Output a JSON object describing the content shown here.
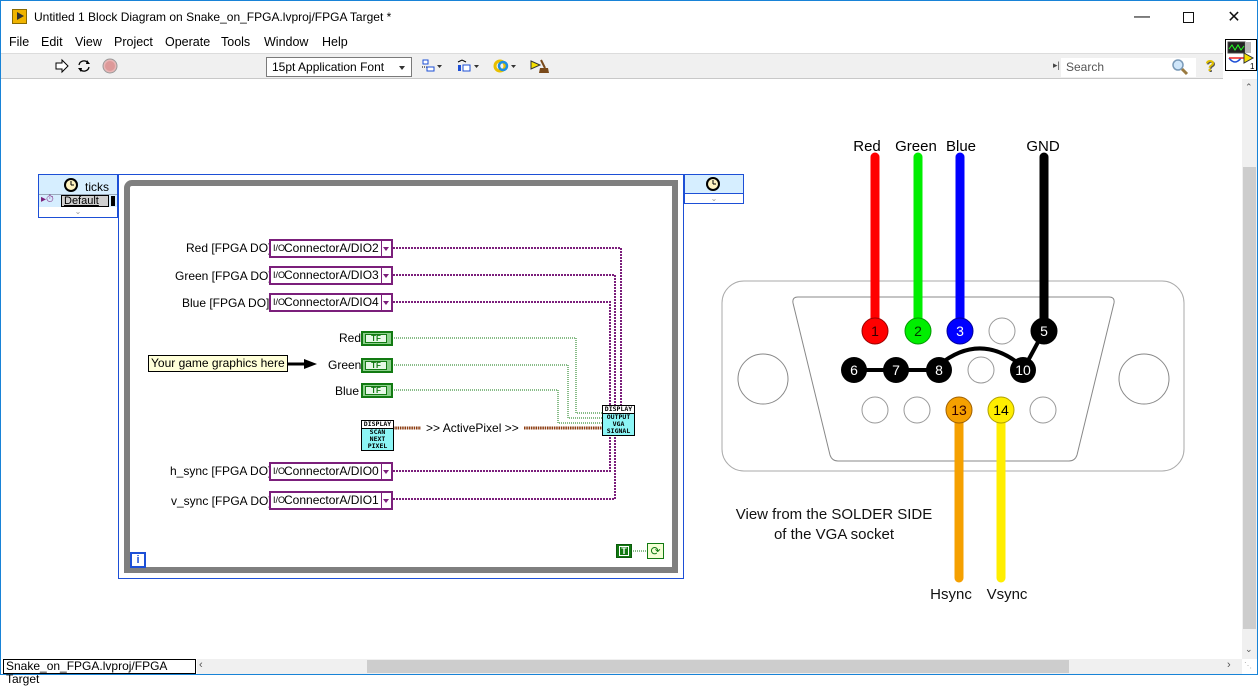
{
  "window": {
    "title": "Untitled 1 Block Diagram on Snake_on_FPGA.lvproj/FPGA Target *",
    "minimize_icon": "minimize-icon",
    "maximize_icon": "maximize-icon",
    "close_icon": "close-icon"
  },
  "menu": [
    "File",
    "Edit",
    "View",
    "Project",
    "Operate",
    "Tools",
    "Window",
    "Help"
  ],
  "toolbar": {
    "run_icon": "run-arrow-icon",
    "run_continuous_icon": "run-continuously-icon",
    "abort_icon": "abort-icon",
    "font_select": "15pt Application Font",
    "align_icon": "align-objects-icon",
    "distribute_icon": "distribute-objects-icon",
    "reorder_icon": "reorder-icon",
    "cleanup_icon": "clean-up-diagram-icon",
    "search_placeholder": "Search",
    "help_icon": "?"
  },
  "diagram": {
    "timed_loop": {
      "source_label": "ticks",
      "timing_source": "Default"
    },
    "io_nodes": [
      {
        "label": "Red [FPGA DO]",
        "channel": "ConnectorA/DIO2"
      },
      {
        "label": "Green [FPGA DO]",
        "channel": "ConnectorA/DIO3"
      },
      {
        "label": "Blue [FPGA DO]",
        "channel": "ConnectorA/DIO4"
      },
      {
        "label": "h_sync [FPGA DO]",
        "channel": "ConnectorA/DIO0"
      },
      {
        "label": "v_sync [FPGA DO]",
        "channel": "ConnectorA/DIO1"
      }
    ],
    "io_icon_text": "I/O",
    "bool_controls": [
      {
        "label": "Red",
        "text": "TF"
      },
      {
        "label": "Green",
        "text": "TF"
      },
      {
        "label": "Blue",
        "text": "TF"
      }
    ],
    "note": "Your game graphics here",
    "subvi_scan": {
      "header": "DISPLAY",
      "lines": [
        "SCAN",
        "NEXT",
        "PIXEL"
      ]
    },
    "subvi_output": {
      "header": "DISPLAY",
      "lines": [
        "OUTPUT",
        "VGA",
        "SIGNAL"
      ]
    },
    "wire_label": ">> ActivePixel >>",
    "iteration_terminal": "i",
    "true_constant": "T"
  },
  "vga_image": {
    "top_labels": [
      "Red",
      "Green",
      "Blue",
      "GND"
    ],
    "pins_row1": [
      "1",
      "2",
      "3",
      "",
      "5"
    ],
    "pins_row2": [
      "6",
      "7",
      "8",
      "",
      "10"
    ],
    "pins_row3": [
      "",
      "",
      "13",
      "14",
      ""
    ],
    "bottom_labels": [
      "Hsync",
      "Vsync"
    ],
    "caption_line1": "View from the SOLDER SIDE",
    "caption_line2": "of the VGA socket",
    "colors": {
      "red": "#ff0000",
      "green": "#00ee00",
      "blue": "#0000ff",
      "gnd": "#000000",
      "hsync": "#f5a000",
      "vsync": "#ffee00"
    }
  },
  "statusbar": {
    "target": "Snake_on_FPGA.lvproj/FPGA Target"
  }
}
